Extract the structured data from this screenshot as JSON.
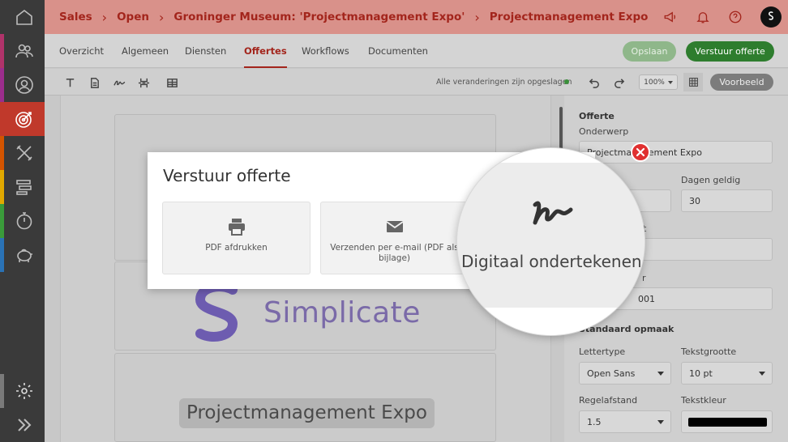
{
  "colors": {
    "accent": "#a3251c",
    "topbar": "#d9918a",
    "primary_green": "#2e7d2e",
    "brand_purple": "#7a6aa8"
  },
  "sidebar": {
    "items": [
      {
        "name": "home-icon"
      },
      {
        "name": "users-icon"
      },
      {
        "name": "user-icon"
      },
      {
        "name": "target-icon",
        "active": true
      },
      {
        "name": "tools-icon"
      },
      {
        "name": "align-icon"
      },
      {
        "name": "stopwatch-icon"
      },
      {
        "name": "piggy-bank-icon"
      }
    ],
    "bottom": [
      {
        "name": "gear-icon"
      },
      {
        "name": "expand-icon"
      }
    ]
  },
  "breadcrumb": [
    "Sales",
    "Open",
    "Groninger Museum: 'Projectmanagement Expo'",
    "Projectmanagement Expo"
  ],
  "tabs": [
    "Overzicht",
    "Algemeen",
    "Diensten",
    "Offertes",
    "Workflows",
    "Documenten"
  ],
  "active_tab": "Offertes",
  "actions": {
    "save": "Opslaan",
    "send": "Verstuur offerte"
  },
  "toolbar": {
    "status": "Alle veranderingen zijn opgeslagen",
    "zoom": "100%",
    "preview": "Voorbeeld"
  },
  "document": {
    "brand": "Simplicate",
    "title": "Projectmanagement Expo"
  },
  "panel": {
    "section_title": "Offerte",
    "subject_label": "Onderwerp",
    "subject_value": "Projectmanagement Expo",
    "days_label": "Dagen geldig",
    "days_value": "30",
    "partial_label_1": "t",
    "partial_label_2": "r",
    "number_partial": "001",
    "style_title": "Standaard opmaak",
    "font_label": "Lettertype",
    "font_value": "Open Sans",
    "size_label": "Tekstgrootte",
    "size_value": "10 pt",
    "spacing_label": "Regelafstand",
    "spacing_value": "1.5",
    "color_label": "Tekstkleur"
  },
  "modal": {
    "title": "Verstuur offerte",
    "options": [
      {
        "label": "PDF afdrukken",
        "icon": "printer-icon"
      },
      {
        "label": "Verzenden per e-mail (PDF als bijlage)",
        "icon": "envelope-icon"
      },
      {
        "label": "Digitaal ondertekenen",
        "icon": "signature-icon"
      }
    ]
  }
}
